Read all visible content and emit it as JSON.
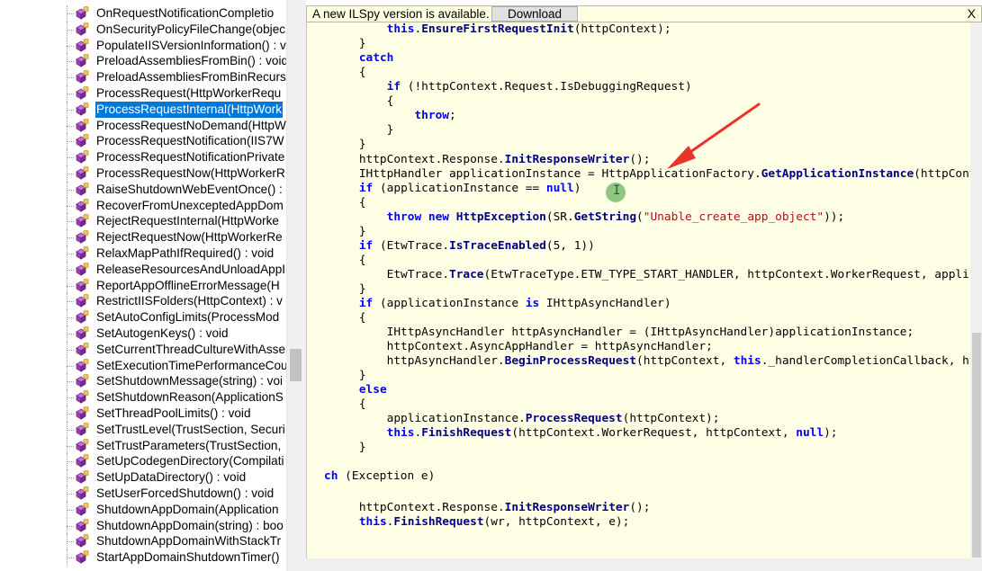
{
  "tree": {
    "items": [
      {
        "label": "OnRequestNotificationCompletio",
        "selected": false
      },
      {
        "label": "OnSecurityPolicyFileChange(objec",
        "selected": false
      },
      {
        "label": "PopulateIISVersionInformation() : v",
        "selected": false
      },
      {
        "label": "PreloadAssembliesFromBin() : void",
        "selected": false
      },
      {
        "label": "PreloadAssembliesFromBinRecurs",
        "selected": false
      },
      {
        "label": "ProcessRequest(HttpWorkerRequ",
        "selected": false
      },
      {
        "label": "ProcessRequestInternal(HttpWork",
        "selected": true
      },
      {
        "label": "ProcessRequestNoDemand(HttpW",
        "selected": false
      },
      {
        "label": "ProcessRequestNotification(IIS7W",
        "selected": false
      },
      {
        "label": "ProcessRequestNotificationPrivate",
        "selected": false
      },
      {
        "label": "ProcessRequestNow(HttpWorkerR",
        "selected": false
      },
      {
        "label": "RaiseShutdownWebEventOnce() : ",
        "selected": false
      },
      {
        "label": "RecoverFromUnexceptedAppDom",
        "selected": false
      },
      {
        "label": "RejectRequestInternal(HttpWorke",
        "selected": false
      },
      {
        "label": "RejectRequestNow(HttpWorkerRe",
        "selected": false
      },
      {
        "label": "RelaxMapPathIfRequired() : void",
        "selected": false
      },
      {
        "label": "ReleaseResourcesAndUnloadAppI",
        "selected": false
      },
      {
        "label": "ReportAppOfflineErrorMessage(H",
        "selected": false
      },
      {
        "label": "RestrictIISFolders(HttpContext) : v",
        "selected": false
      },
      {
        "label": "SetAutoConfigLimits(ProcessMod",
        "selected": false
      },
      {
        "label": "SetAutogenKeys() : void",
        "selected": false
      },
      {
        "label": "SetCurrentThreadCultureWithAsse",
        "selected": false
      },
      {
        "label": "SetExecutionTimePerformanceCou",
        "selected": false
      },
      {
        "label": "SetShutdownMessage(string) : voi",
        "selected": false
      },
      {
        "label": "SetShutdownReason(ApplicationS",
        "selected": false
      },
      {
        "label": "SetThreadPoolLimits() : void",
        "selected": false
      },
      {
        "label": "SetTrustLevel(TrustSection, Securi",
        "selected": false
      },
      {
        "label": "SetTrustParameters(TrustSection, ",
        "selected": false
      },
      {
        "label": "SetUpCodegenDirectory(Compilati",
        "selected": false
      },
      {
        "label": "SetUpDataDirectory() : void",
        "selected": false
      },
      {
        "label": "SetUserForcedShutdown() : void",
        "selected": false
      },
      {
        "label": "ShutdownAppDomain(Application",
        "selected": false
      },
      {
        "label": "ShutdownAppDomain(string) : boo",
        "selected": false
      },
      {
        "label": "ShutdownAppDomainWithStackTr",
        "selected": false
      },
      {
        "label": "StartAppDomainShutdownTimer()",
        "selected": false
      }
    ],
    "icon": "private-method-icon"
  },
  "notification": {
    "text": "A new ILSpy version is available.",
    "button_label": "Download",
    "close_label": "X"
  },
  "colors": {
    "keyword": "#0000ff",
    "member": "#000080",
    "string": "#a31515",
    "selection": "#0078d7",
    "code_background": "#ffffe6",
    "annotation_arrow": "#e8352b"
  },
  "code": {
    "lines": [
      [
        {
          "t": "        "
        },
        {
          "t": "this",
          "c": "k"
        },
        {
          "t": "."
        },
        {
          "t": "EnsureFirstRequestInit",
          "c": "b"
        },
        {
          "t": "(httpContext);"
        }
      ],
      [
        {
          "t": "    }"
        }
      ],
      [
        {
          "t": "    "
        },
        {
          "t": "catch",
          "c": "k"
        }
      ],
      [
        {
          "t": "    {"
        }
      ],
      [
        {
          "t": "        "
        },
        {
          "t": "if",
          "c": "k"
        },
        {
          "t": " (!httpContext.Request.IsDebuggingRequest)"
        }
      ],
      [
        {
          "t": "        {"
        }
      ],
      [
        {
          "t": "            "
        },
        {
          "t": "throw",
          "c": "k"
        },
        {
          "t": ";"
        }
      ],
      [
        {
          "t": "        }"
        }
      ],
      [
        {
          "t": "    }"
        }
      ],
      [
        {
          "t": "    httpContext.Response."
        },
        {
          "t": "InitResponseWriter",
          "c": "b"
        },
        {
          "t": "();"
        }
      ],
      [
        {
          "t": "    IHttpHandler applicationInstance = HttpApplicationFactory."
        },
        {
          "t": "GetApplicationInstance",
          "c": "b"
        },
        {
          "t": "(httpContext)"
        }
      ],
      [
        {
          "t": "    "
        },
        {
          "t": "if",
          "c": "k"
        },
        {
          "t": " (applicationInstance == "
        },
        {
          "t": "null",
          "c": "k"
        },
        {
          "t": ")"
        }
      ],
      [
        {
          "t": "    {"
        }
      ],
      [
        {
          "t": "        "
        },
        {
          "t": "throw new",
          "c": "k"
        },
        {
          "t": " "
        },
        {
          "t": "HttpException",
          "c": "b"
        },
        {
          "t": "(SR."
        },
        {
          "t": "GetString",
          "c": "b"
        },
        {
          "t": "("
        },
        {
          "t": "\"Unable_create_app_object\"",
          "c": "s"
        },
        {
          "t": "));"
        }
      ],
      [
        {
          "t": "    }"
        }
      ],
      [
        {
          "t": "    "
        },
        {
          "t": "if",
          "c": "k"
        },
        {
          "t": " (EtwTrace."
        },
        {
          "t": "IsTraceEnabled",
          "c": "b"
        },
        {
          "t": "(5, 1))"
        }
      ],
      [
        {
          "t": "    {"
        }
      ],
      [
        {
          "t": "        EtwTrace."
        },
        {
          "t": "Trace",
          "c": "b"
        },
        {
          "t": "(EtwTraceType.ETW_TYPE_START_HANDLER, httpContext.WorkerRequest, applicatio"
        }
      ],
      [
        {
          "t": "    }"
        }
      ],
      [
        {
          "t": "    "
        },
        {
          "t": "if",
          "c": "k"
        },
        {
          "t": " (applicationInstance "
        },
        {
          "t": "is",
          "c": "k"
        },
        {
          "t": " IHttpAsyncHandler)"
        }
      ],
      [
        {
          "t": "    {"
        }
      ],
      [
        {
          "t": "        IHttpAsyncHandler httpAsyncHandler = (IHttpAsyncHandler)applicationInstance;"
        }
      ],
      [
        {
          "t": "        httpContext.AsyncAppHandler = httpAsyncHandler;"
        }
      ],
      [
        {
          "t": "        httpAsyncHandler."
        },
        {
          "t": "BeginProcessRequest",
          "c": "b"
        },
        {
          "t": "(httpContext, "
        },
        {
          "t": "this",
          "c": "k"
        },
        {
          "t": "._handlerCompletionCallback, httpCo"
        }
      ],
      [
        {
          "t": "    }"
        }
      ],
      [
        {
          "t": "    "
        },
        {
          "t": "else",
          "c": "k"
        }
      ],
      [
        {
          "t": "    {"
        }
      ],
      [
        {
          "t": "        applicationInstance."
        },
        {
          "t": "ProcessRequest",
          "c": "b"
        },
        {
          "t": "(httpContext);"
        }
      ],
      [
        {
          "t": "        "
        },
        {
          "t": "this",
          "c": "k"
        },
        {
          "t": "."
        },
        {
          "t": "FinishRequest",
          "c": "b"
        },
        {
          "t": "(httpContext.WorkerRequest, httpContext, "
        },
        {
          "t": "null",
          "c": "k"
        },
        {
          "t": ");"
        }
      ],
      [
        {
          "t": "    }"
        }
      ],
      [
        {
          "t": ""
        }
      ],
      [
        {
          "t": "ch",
          "c": "k"
        },
        {
          "t": " (Exception e)"
        }
      ],
      [
        {
          "t": ""
        }
      ],
      [
        {
          "t": "    httpContext.Response."
        },
        {
          "t": "InitResponseWriter",
          "c": "b"
        },
        {
          "t": "();"
        }
      ],
      [
        {
          "t": "    "
        },
        {
          "t": "this",
          "c": "k"
        },
        {
          "t": "."
        },
        {
          "t": "FinishRequest",
          "c": "b"
        },
        {
          "t": "(wr, httpContext, e);"
        }
      ]
    ]
  }
}
